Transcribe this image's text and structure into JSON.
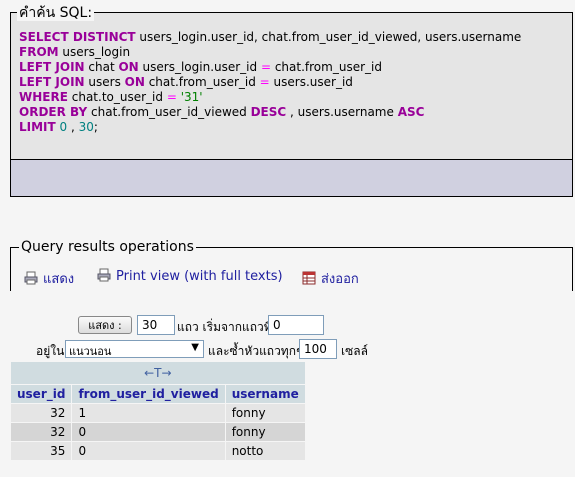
{
  "sql_box": {
    "legend": "คำค้น SQL:",
    "lines": [
      [
        [
          "kw",
          "SELECT DISTINCT"
        ],
        [
          "t",
          " users_login.user_id, chat.from_user_id_viewed, users.username"
        ]
      ],
      [
        [
          "kw",
          "FROM"
        ],
        [
          "t",
          " users_login"
        ]
      ],
      [
        [
          "kw",
          "LEFT JOIN"
        ],
        [
          "t",
          " chat "
        ],
        [
          "kw",
          "ON"
        ],
        [
          "t",
          " users_login.user_id "
        ],
        [
          "op",
          "="
        ],
        [
          "t",
          " chat.from_user_id"
        ]
      ],
      [
        [
          "kw",
          "LEFT JOIN"
        ],
        [
          "t",
          " users "
        ],
        [
          "kw",
          "ON"
        ],
        [
          "t",
          " chat.from_user_id "
        ],
        [
          "op",
          "="
        ],
        [
          "t",
          " users.user_id"
        ]
      ],
      [
        [
          "kw",
          "WHERE"
        ],
        [
          "t",
          " chat.to_user_id "
        ],
        [
          "op",
          "="
        ],
        [
          "t",
          " "
        ],
        [
          "str",
          "'31'"
        ]
      ],
      [
        [
          "kw",
          "ORDER BY"
        ],
        [
          "t",
          " chat.from_user_id_viewed "
        ],
        [
          "kw",
          "DESC"
        ],
        [
          "t",
          " , users.username "
        ],
        [
          "kw",
          "ASC"
        ]
      ],
      [
        [
          "kw",
          "LIMIT"
        ],
        [
          "t",
          " "
        ],
        [
          "num",
          "0"
        ],
        [
          "t",
          " , "
        ],
        [
          "num",
          "30"
        ],
        [
          "t",
          ";"
        ]
      ]
    ]
  },
  "ops": {
    "legend": "Query results operations",
    "show_label": "แสดง",
    "print_label": "Print view (with full texts)",
    "export_label": "ส่งออก"
  },
  "nav": {
    "show_button": "แสดง :",
    "rows_value": "30",
    "rows_text": "แถว เริ่มจากแถวที่",
    "start_value": "0",
    "in_text": "อยู่ใน",
    "mode_value": "แนวนอน",
    "repeat_text": "และซ้ำหัวแถวทุกๆ",
    "repeat_value": "100",
    "cells_text": "เซลล์"
  },
  "table": {
    "arrow": "←T→",
    "headers": [
      "user_id",
      "from_user_id_viewed",
      "username"
    ],
    "rows": [
      [
        "32",
        "1",
        "fonny"
      ],
      [
        "32",
        "0",
        "fonny"
      ],
      [
        "35",
        "0",
        "notto"
      ]
    ]
  }
}
